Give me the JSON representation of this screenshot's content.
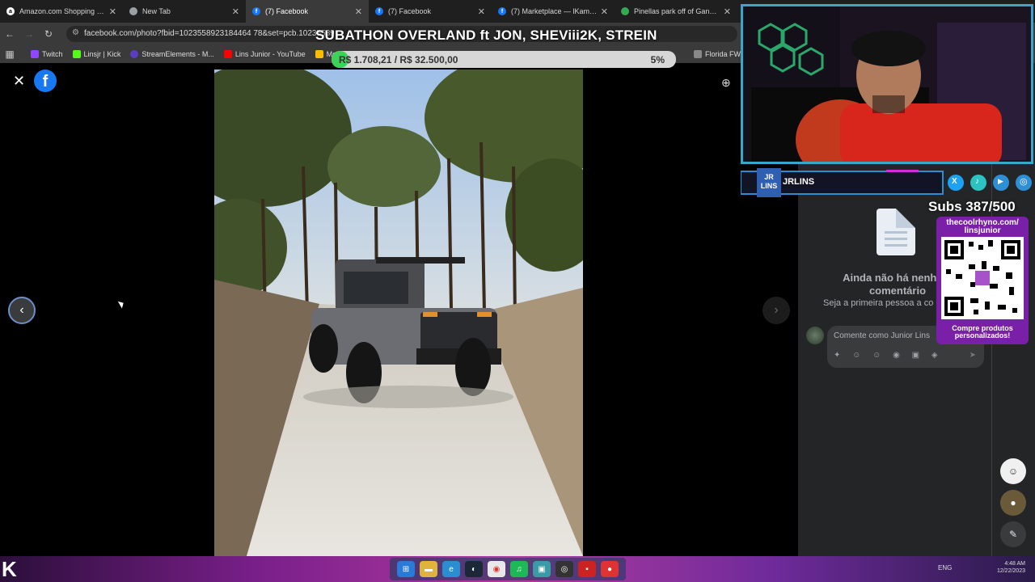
{
  "browser": {
    "tabs": [
      {
        "title": "Amazon.com Shopping Cart",
        "icon": "amazon-icon",
        "color": "#ffffff"
      },
      {
        "title": "New Tab",
        "icon": "chrome-icon",
        "color": "#9aa0a6"
      },
      {
        "title": "(7) Facebook",
        "icon": "facebook-icon",
        "color": "#1877f2",
        "active": true
      },
      {
        "title": "(7) Facebook",
        "icon": "facebook-icon",
        "color": "#1877f2"
      },
      {
        "title": "(7) Marketplace — lKamper S",
        "icon": "facebook-icon",
        "color": "#1877f2"
      },
      {
        "title": "Pinellas park off of Gandy - G",
        "icon": "maps-pin-icon",
        "color": "#34a853"
      }
    ],
    "url": "facebook.com/photo?fbid=1023558923184464 78&set=pcb.10235589",
    "bookmarks": [
      {
        "label": "Twitch",
        "color": "#9146ff"
      },
      {
        "label": "Linsjr | Kick",
        "color": "#53fc18"
      },
      {
        "label": "StreamElements - M...",
        "color": "#5b3cc4"
      },
      {
        "label": "Lins Junior - YouTube",
        "color": "#ff0000"
      },
      {
        "label": "Meu Drive",
        "color": "#fbbc04"
      },
      {
        "label": "Florida FWC",
        "color": "#888888"
      }
    ]
  },
  "overlay": {
    "stream_title": "SUBATHON OVERLAND ft JON, SHEViii2K, STREIN",
    "goal_text": "R$ 1.708,21 / R$ 32.500,00",
    "goal_percent_label": "5%",
    "goal_fraction": 0.05,
    "channel_name": "JRLINS",
    "logo_text": "JR LINS",
    "subs": "Subs 387/500",
    "qr_url": "thecoolrhyno.com/ linsjunior",
    "qr_cta": "Compre produtos personalizados!",
    "social_icons": [
      "x-icon",
      "tiktok-icon",
      "youtube-icon",
      "instagram-icon"
    ]
  },
  "viewer": {
    "close_icon": "close-icon",
    "brand": "f",
    "zoom_icon": "zoom-in-icon",
    "prev_icon": "chevron-left-icon",
    "next_icon": "chevron-right-icon",
    "photo_description_hidden": ""
  },
  "comments": {
    "empty_title": "Ainda não há nenhum comentário",
    "empty_sub": "Seja a primeira pessoa a co",
    "placeholder": "Comente como Junior Lins",
    "tools": "✦ ☺ ☺ ◉ ▣ ◈",
    "send_icon": "send-icon"
  },
  "taskbar": {
    "tray_lang": "ENG",
    "time": "4:48 AM",
    "date": "12/22/2023"
  }
}
